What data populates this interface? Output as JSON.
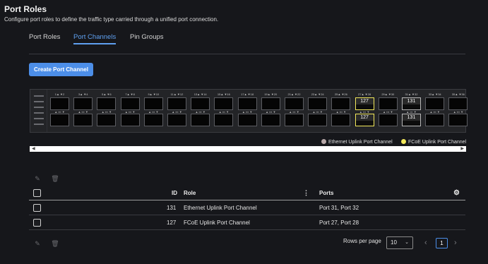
{
  "header": {
    "title": "Port Roles",
    "subtitle": "Configure port roles to define the traffic type carried through a unified port connection."
  },
  "tabs": [
    {
      "label": "Port Roles",
      "active": false
    },
    {
      "label": "Port Channels",
      "active": true
    },
    {
      "label": "Pin Groups",
      "active": false
    }
  ],
  "actions": {
    "create_label": "Create Port Channel"
  },
  "switch": {
    "pairs": [
      {
        "top": "1",
        "bottom": "2"
      },
      {
        "top": "3",
        "bottom": "4"
      },
      {
        "top": "5",
        "bottom": "6"
      },
      {
        "top": "7",
        "bottom": "8"
      },
      {
        "top": "9",
        "bottom": "10"
      },
      {
        "top": "11",
        "bottom": "12"
      },
      {
        "top": "13",
        "bottom": "14"
      },
      {
        "top": "15",
        "bottom": "16"
      },
      {
        "top": "17",
        "bottom": "18"
      },
      {
        "top": "19",
        "bottom": "20"
      },
      {
        "top": "21",
        "bottom": "22"
      },
      {
        "top": "23",
        "bottom": "24"
      },
      {
        "top": "25",
        "bottom": "26"
      },
      {
        "top": "27",
        "bottom": "28",
        "role": "fcoe",
        "top_label": "127",
        "bottom_label": "127"
      },
      {
        "top": "29",
        "bottom": "30"
      },
      {
        "top": "31",
        "bottom": "32",
        "role": "eth",
        "top_label": "131",
        "bottom_label": "131"
      },
      {
        "top": "33",
        "bottom": "34"
      },
      {
        "top": "35",
        "bottom": "36"
      }
    ]
  },
  "legend": [
    {
      "label": "Ethernet Uplink Port Channel",
      "color": "#b7a8a8"
    },
    {
      "label": "FCoE Uplink Port Channel",
      "color": "#f2e85a"
    }
  ],
  "table": {
    "columns": {
      "id": "ID",
      "role": "Role",
      "ports": "Ports"
    },
    "rows": [
      {
        "id": "131",
        "role": "Ethernet Uplink Port Channel",
        "ports": "Port 31, Port 32"
      },
      {
        "id": "127",
        "role": "FCoE Uplink Port Channel",
        "ports": "Port 27, Port 28"
      }
    ]
  },
  "pagination": {
    "rows_per_page_label": "Rows per page",
    "rows_per_page_value": "10",
    "current_page": "1"
  },
  "colors": {
    "accent": "#4c8ee8",
    "background": "#16171b"
  }
}
